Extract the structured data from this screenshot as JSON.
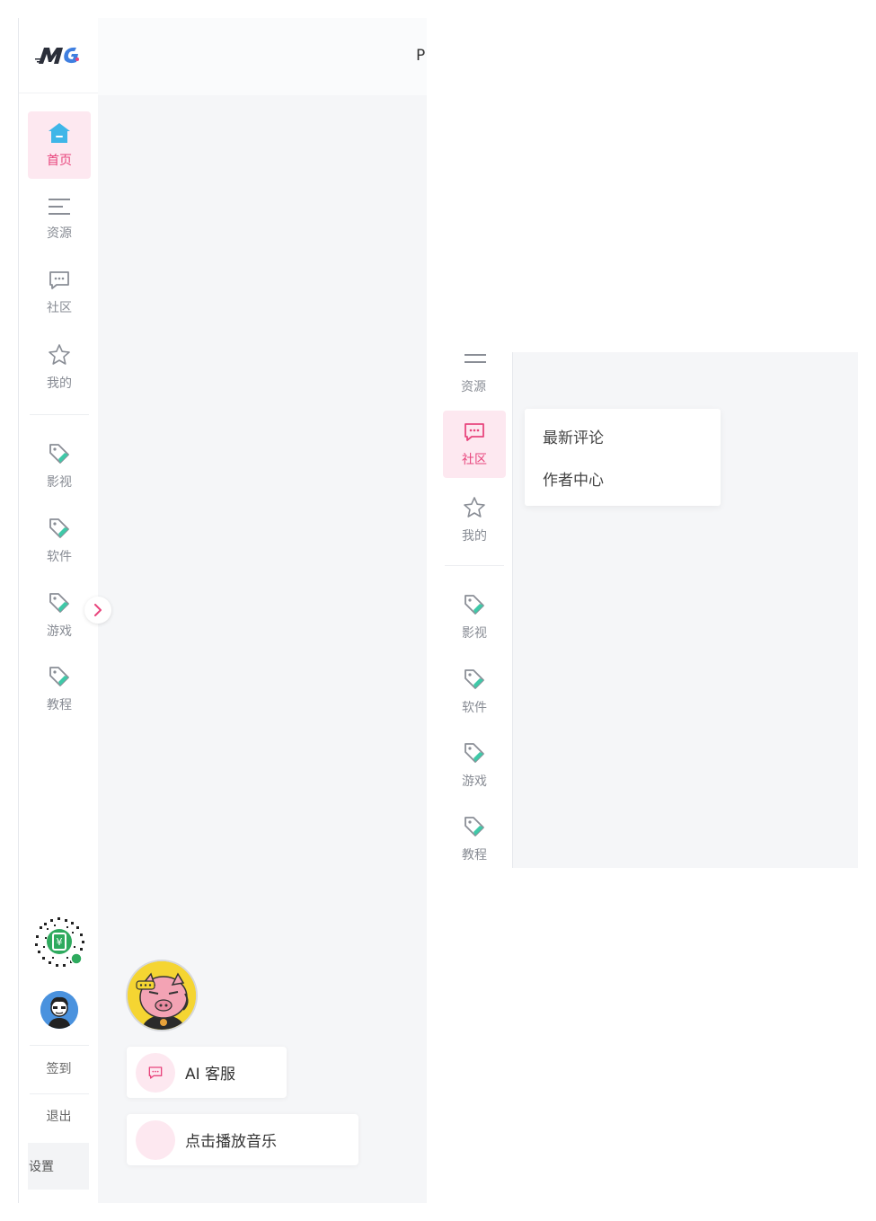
{
  "header": {
    "partial_text": "P"
  },
  "sidebar": {
    "items": [
      {
        "label": "首页",
        "icon": "home-icon",
        "active": true
      },
      {
        "label": "资源",
        "icon": "menu-lines-icon"
      },
      {
        "label": "社区",
        "icon": "chat-bubble-icon"
      },
      {
        "label": "我的",
        "icon": "star-icon"
      },
      {
        "label": "影视",
        "icon": "tag-icon"
      },
      {
        "label": "软件",
        "icon": "tag-icon"
      },
      {
        "label": "游戏",
        "icon": "tag-icon"
      },
      {
        "label": "教程",
        "icon": "tag-icon"
      }
    ],
    "checkin_label": "签到",
    "logout_label": "退出",
    "settings_label": "设置"
  },
  "floating": {
    "ai_service_label": "AI 客服",
    "music_label": "点击播放音乐"
  },
  "right_panel": {
    "items": [
      {
        "label": "资源",
        "icon": "menu-lines-icon"
      },
      {
        "label": "社区",
        "icon": "chat-bubble-icon",
        "active": true
      },
      {
        "label": "我的",
        "icon": "star-icon"
      },
      {
        "label": "影视",
        "icon": "tag-icon"
      },
      {
        "label": "软件",
        "icon": "tag-icon"
      },
      {
        "label": "游戏",
        "icon": "tag-icon"
      },
      {
        "label": "教程",
        "icon": "tag-icon"
      }
    ],
    "dropdown": [
      "最新评论",
      "作者中心"
    ]
  },
  "colors": {
    "accent": "#e8457d",
    "accent_bg": "#fde8f0",
    "tag_green": "#3fc9a8",
    "home_blue": "#3fb6e8"
  }
}
